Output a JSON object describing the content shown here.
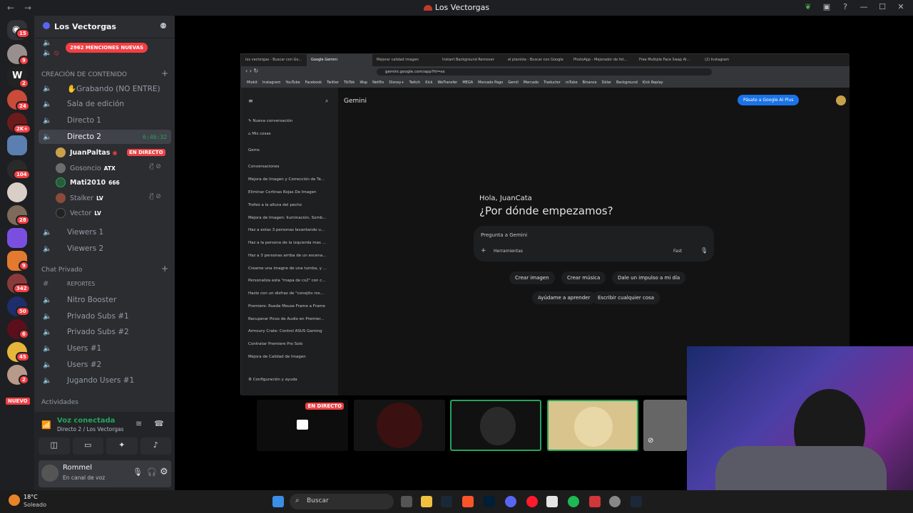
{
  "window": {
    "title": "Los Vectorgas"
  },
  "rail": {
    "badges": [
      "15",
      "9",
      "2",
      "24",
      "2K+",
      "104",
      "28",
      "9",
      "342",
      "50",
      "6",
      "45",
      "2"
    ],
    "new_label": "NUEVO"
  },
  "server": {
    "name": "Los Vectorgas",
    "mention_pill": "2962 MENCIONES NUEVAS"
  },
  "categories": {
    "creation": "CREACIÓN DE CONTENIDO",
    "private": "Chat Privado",
    "activities": "Actividades"
  },
  "channels": {
    "grabando": "✋Grabando (NO ENTRE)",
    "sala": "Sala de edición",
    "directo1": "Directo 1",
    "directo2": "Directo 2",
    "directo2_time": "6:46:32",
    "viewers1": "Viewers 1",
    "viewers2": "Viewers 2",
    "reportes": "REPORTES",
    "nitro": "Nitro Booster",
    "privsubs1": "Privado Subs #1",
    "privsubs2": "Privado Subs #2",
    "users1": "Users #1",
    "users2": "Users #2",
    "jugando": "Jugando Users #1"
  },
  "voice_users": [
    {
      "name": "JuanPaltas",
      "tag": "",
      "live": "EN DIRECTO"
    },
    {
      "name": "Gosoncio",
      "tag": "ATX"
    },
    {
      "name": "Mati2010",
      "tag": "666"
    },
    {
      "name": "Stalker",
      "tag": "LV"
    },
    {
      "name": "Vector",
      "tag": "LV"
    }
  ],
  "voice_panel": {
    "status": "Voz conectada",
    "location": "Directo 2 / Los Vectorgas"
  },
  "user_panel": {
    "name": "Rommel",
    "status": "En canal de voz"
  },
  "browser": {
    "tabs": [
      "los vectorgas - Buscar con Go...",
      "Google Gemini",
      "Mejorar calidad imagen",
      "Instant Background Remover",
      "el planista - Buscar con Google",
      "PhotoApp - Mejorador de fot...",
      "Free Multiple Face Swap AI...",
      "(2) Instagram"
    ],
    "url": "gemini.google.com/app?hl=es",
    "bookmarks": [
      "Mixkit",
      "Instagram",
      "YouTube",
      "Facebook",
      "Twitter",
      "TikTok",
      "Wsp",
      "Netflix",
      "Disney+",
      "Twitch",
      "Kick",
      "WeTransfer",
      "MEGA",
      "Mercado Pago",
      "Gemil",
      "Mercado",
      "Traductor",
      "roTube",
      "Binance",
      "Dólar",
      "Background",
      "Kick Replay"
    ]
  },
  "gemini": {
    "brand": "Gemini",
    "new_chat": "Nueva conversación",
    "my_stuff": "Mis cosas",
    "gems": "Gems",
    "conversations": "Conversaciones",
    "history": [
      "Mejora de Imagen y Corrección de Te...",
      "Eliminar Cortinas Rojas De Imagen",
      "Trofeo a la altura del pecho",
      "Mejora de Imagen: Iluminación, Somb...",
      "Haz a estas 3 personas levantando u...",
      "Haz a la persona de la izquierda mas ...",
      "Haz a 3 personas arriba de un escena...",
      "Creame una imagne de una tumba, y ...",
      "Personaliza esta \"mapa de cs2\" con c...",
      "Hazlo con un disfraz de \"conejito ros...",
      "Premiere: Rueda Mouse Frame a Frame",
      "Recuperar Picos de Audio en Premier...",
      "Armoury Crate: Control ASUS Gaming",
      "Contratar Premiere Pro Solo",
      "Mejora de Calidad de Imagen"
    ],
    "settings": "Configuración y ayuda",
    "upgrade": "Pásate a Google AI Plus",
    "greeting": "Hola, JuanCata",
    "prompt": "¿Por dónde empezamos?",
    "input_placeholder": "Pregunta a Gemini",
    "tools": "Herramientas",
    "mode": "Fast",
    "chips": [
      "Crear imagen",
      "Crear música",
      "Dale un impulso a mi día",
      "Ayúdame a aprender",
      "Escribir cualquier cosa"
    ]
  },
  "stream": {
    "live_badge": "EN DIRECTO"
  },
  "taskbar": {
    "weather_temp": "18°C",
    "weather_desc": "Soleado",
    "search": "Buscar"
  }
}
